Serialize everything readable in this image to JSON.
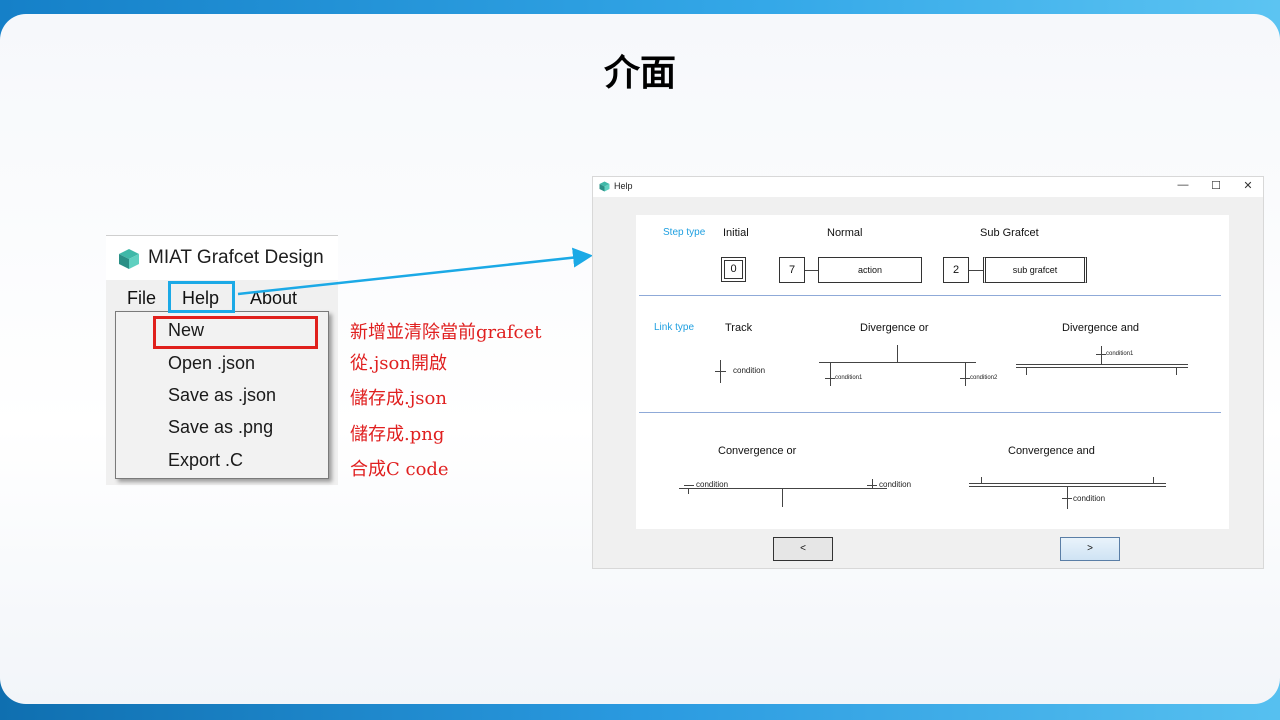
{
  "slide": {
    "title": "介面"
  },
  "app": {
    "title": "MIAT Grafcet Design",
    "menu": {
      "file": "File",
      "help": "Help",
      "about": "About"
    },
    "file_menu_items": [
      "New",
      "Open .json",
      "Save as .json",
      "Save as .png",
      "Export .C"
    ]
  },
  "notes": [
    "新增並清除當前grafcet",
    "從.json開啟",
    "儲存成.json",
    "儲存成.png",
    "合成C code"
  ],
  "help_window": {
    "title": "Help",
    "step_type": {
      "label": "Step type",
      "initial": {
        "label": "Initial",
        "value": "0"
      },
      "normal": {
        "label": "Normal",
        "value": "7",
        "action": "action"
      },
      "sub_grafcet": {
        "label": "Sub Grafcet",
        "value": "2",
        "box": "sub grafcet"
      }
    },
    "link_type": {
      "label": "Link type",
      "track": {
        "label": "Track",
        "condition": "condition"
      },
      "divergence_or": {
        "label": "Divergence or",
        "condition1": "condition1",
        "condition2": "condition2"
      },
      "divergence_and": {
        "label": "Divergence and",
        "condition1": "condition1"
      }
    },
    "convergence_or": {
      "label": "Convergence or",
      "condition_left": "condition",
      "condition_right": "condition"
    },
    "convergence_and": {
      "label": "Convergence and",
      "condition": "condition"
    },
    "prev_button": "<",
    "next_button": ">"
  },
  "colors": {
    "accent_blue": "#1ba9e6",
    "highlight_red": "#e0201c",
    "note_red": "#e02020"
  }
}
